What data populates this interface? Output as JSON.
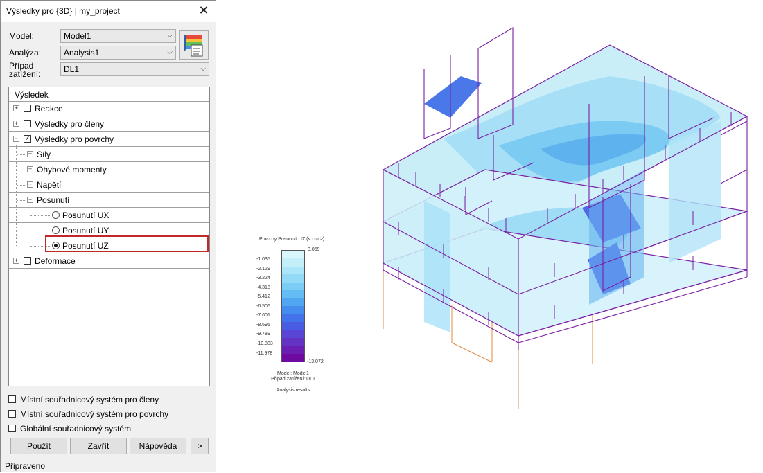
{
  "dialog": {
    "title": "Výsledky pro {3D} | my_project",
    "close_glyph": "✕",
    "model_label": "Model:",
    "model_value": "Model1",
    "analysis_label": "Analýza:",
    "analysis_value": "Analysis1",
    "loadcase_label_1": "Případ",
    "loadcase_label_2": "zatížení:",
    "loadcase_value": "DL1",
    "tree": {
      "header": "Výsledek",
      "reactions": "Reakce",
      "member_results": "Výsledky pro členy",
      "surface_results": "Výsledky pro povrchy",
      "forces": "Síly",
      "bending_moments": "Ohybové momenty",
      "stresses": "Napětí",
      "displacements": "Posunutí",
      "ux": "Posunutí UX",
      "uy": "Posunutí UY",
      "uz": "Posunutí UZ",
      "deformation": "Deformace"
    },
    "options": {
      "local_members": "Místní souřadnicový systém pro členy",
      "local_surfaces": "Místní souřadnicový systém pro povrchy",
      "global": "Globální souřadnicový systém"
    },
    "buttons": {
      "apply": "Použít",
      "close": "Zavřít",
      "help": "Nápověda",
      "more": ">"
    },
    "status": "Připraveno"
  },
  "legend": {
    "title": "Povrchy Posunutí UZ (< cm >)",
    "max": "0.059",
    "min": "-13.072",
    "ticks": [
      "-1.035",
      "-2.129",
      "-3.224",
      "-4.318",
      "-5.412",
      "-6.506",
      "-7.601",
      "-8.695",
      "-9.789",
      "-10.883",
      "-11.978"
    ],
    "colors": [
      "#d8f6fb",
      "#c4effa",
      "#abe5f9",
      "#92daf8",
      "#7bcdf6",
      "#64bcf4",
      "#50a6f1",
      "#448ced",
      "#4273ea",
      "#4a5ce4",
      "#5946d6",
      "#6533c4",
      "#6b1fb2",
      "#6f0aa0"
    ],
    "model_line": "Model: Model1",
    "case_line": "Případ zatížení: DL1",
    "source_line": "Analysis results"
  }
}
